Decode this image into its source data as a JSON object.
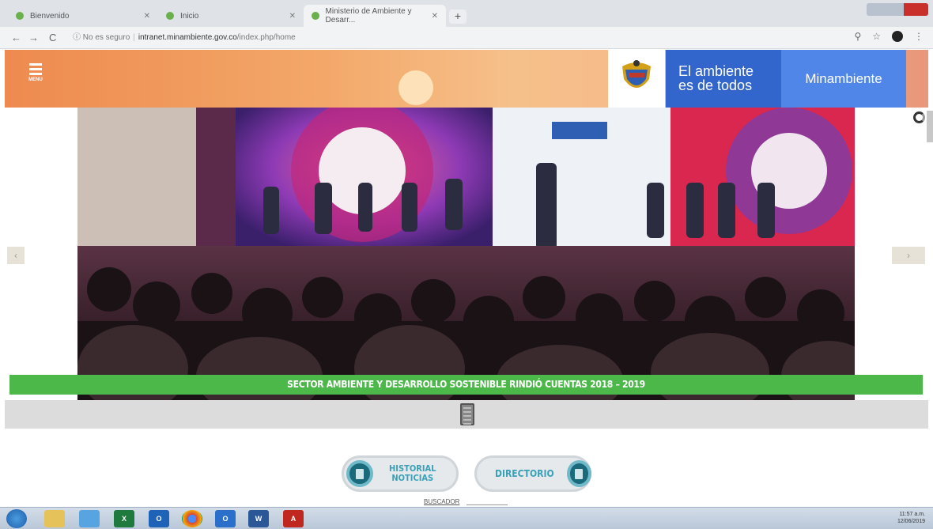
{
  "browser": {
    "tabs": [
      {
        "title": "Bienvenido"
      },
      {
        "title": "Inicio"
      },
      {
        "title": "Ministerio de Ambiente y Desarr..."
      }
    ],
    "new_tab_label": "+",
    "nav": {
      "back": "←",
      "forward": "→",
      "reload": "C"
    },
    "address": {
      "security": "No es seguro",
      "host": "intranet.minambiente.gov.co",
      "path": "/index.php/home"
    },
    "icons": {
      "zoom": "search-icon",
      "star": "star-icon",
      "menu": "kebab-icon"
    }
  },
  "header": {
    "menu_label": "MENU",
    "brand_line1": "El ambiente",
    "brand_line2": "es de todos",
    "brand_name": "Minambiente",
    "colors": {
      "brand_dark": "#3366cc",
      "brand_light": "#4f86e8",
      "header_orange": "#ee8a4f"
    }
  },
  "slider": {
    "caption": "SECTOR AMBIENTE Y DESARROLLO SOSTENIBLE RINDIÓ CUENTAS 2018 – 2019",
    "prev_label": "‹",
    "next_label": "›",
    "caption_color": "#4cb84a"
  },
  "quicklinks": [
    {
      "line1": "HISTORIAL",
      "line2": "NOTICIAS"
    },
    {
      "line1": "DIRECTORIO",
      "line2": ""
    }
  ],
  "search_label": "BUSCADOR",
  "taskbar": {
    "apps": [
      "X",
      "O",
      "",
      "O",
      "W",
      "A"
    ],
    "clock_time": "11:57 a.m.",
    "clock_date": "12/06/2019"
  }
}
